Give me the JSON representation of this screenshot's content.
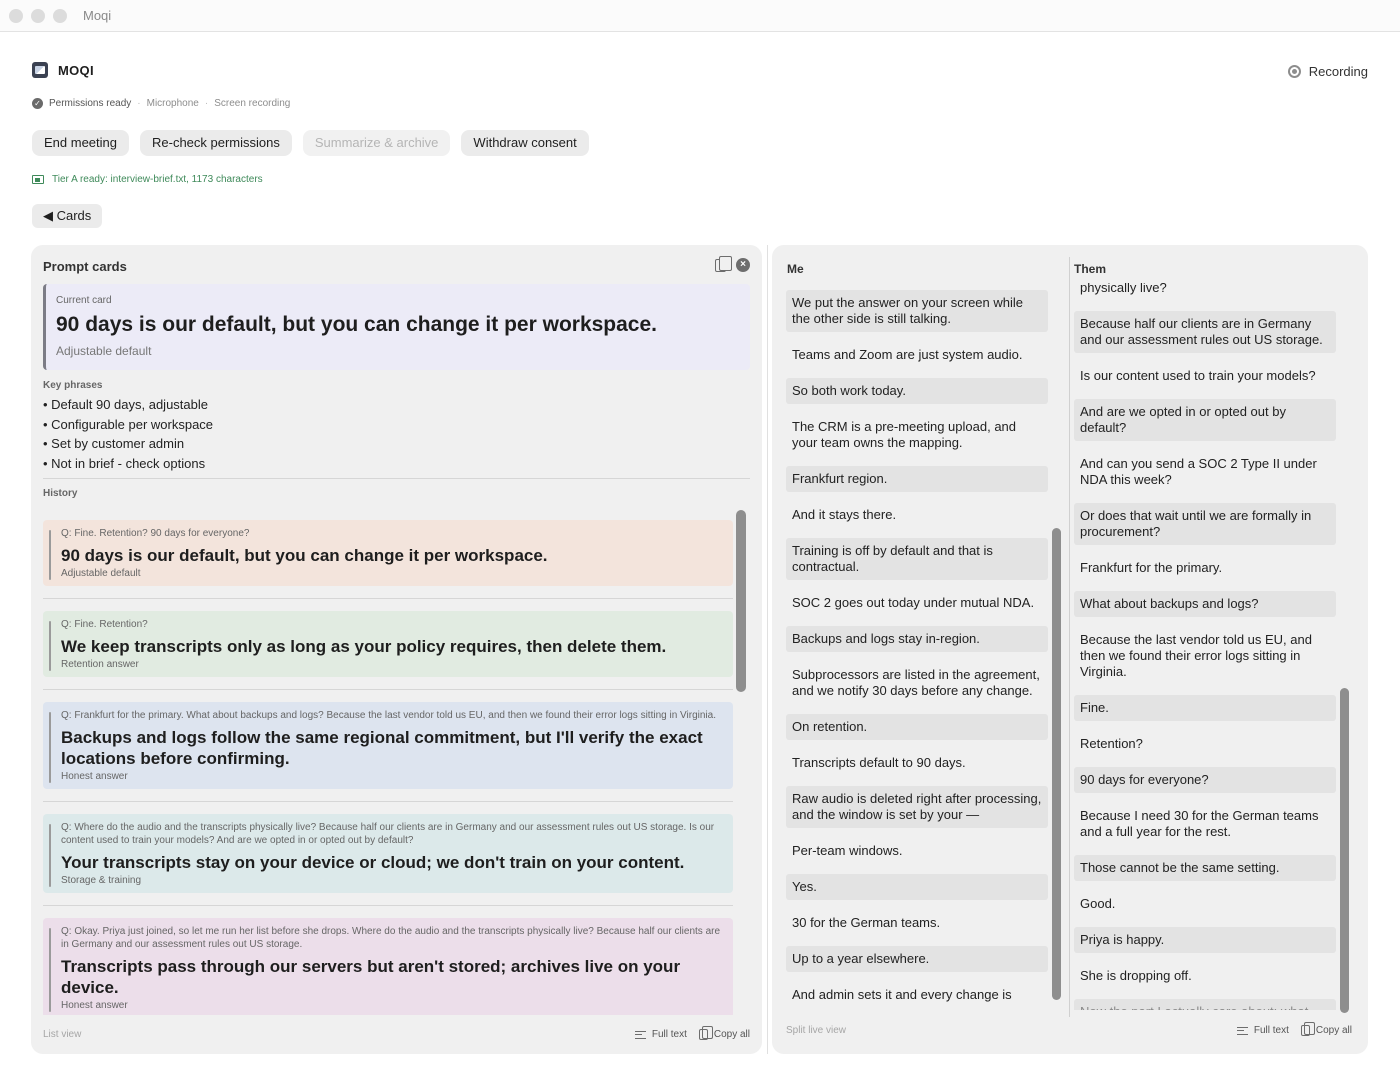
{
  "window": {
    "title": "Moqi"
  },
  "app": {
    "name": "MOQI",
    "recording_label": "Recording"
  },
  "permissions": {
    "ready": "Permissions ready",
    "microphone": "Microphone",
    "screen": "Screen recording",
    "separator": "·"
  },
  "buttons": {
    "end_meeting": "End meeting",
    "recheck": "Re-check permissions",
    "summarize": "Summarize & archive",
    "withdraw": "Withdraw consent"
  },
  "tier": {
    "text": "Tier A ready: interview-brief.txt, 1173 characters"
  },
  "cards_toggle": "◀ Cards",
  "prompt_panel": {
    "title": "Prompt cards",
    "current_card": {
      "label": "Current card",
      "title": "90 days is our default, but you can change it per workspace.",
      "subtitle": "Adjustable default"
    },
    "key_phrases_label": "Key phrases",
    "key_phrases": [
      "• Default 90 days, adjustable",
      "• Configurable per workspace",
      "• Set by customer admin",
      "• Not in brief - check options"
    ],
    "history_label": "History",
    "history": [
      {
        "q": "Q: Fine.  Retention?  90 days for everyone?",
        "a": "90 days is our default, but you can change it per workspace.",
        "tag": "Adjustable default",
        "color": "#f3e4dc"
      },
      {
        "q": "Q: Fine.  Retention?",
        "a": "We keep transcripts only as long as your policy requires, then delete them.",
        "tag": "Retention answer",
        "color": "#e1ebe1"
      },
      {
        "q": "Q: Frankfurt for the primary.  What about backups and logs?  Because the last vendor told us EU, and then we found their error logs sitting in Virginia.",
        "a": "Backups and logs follow the same regional commitment, but I'll verify the exact locations before confirming.",
        "tag": "Honest answer",
        "color": "#dde4ef"
      },
      {
        "q": "Q: Where do the audio and the transcripts physically live?  Because half our clients are in Germany and our assessment rules out US storage.  Is our content used to train your models?  And are we opted in or opted out by default?",
        "a": "Your transcripts stay on your device or cloud; we don't train on your content.",
        "tag": "Storage & training",
        "color": "#dce9ea"
      },
      {
        "q": "Q: Okay.  Priya just joined, so let me run her list before she drops.  Where do the audio and the transcripts physically live?  Because half our clients are in Germany and our assessment rules out US storage.",
        "a": "Transcripts pass through our servers but aren't stored; archives live on your device.",
        "tag": "Honest answer",
        "color": "#ecdeea"
      }
    ],
    "footer": {
      "view": "List view",
      "full_text": "Full text",
      "copy_all": "Copy all"
    }
  },
  "live_panel": {
    "me_label": "Me",
    "them_label": "Them",
    "me": [
      "We put the answer on your screen while the other side is still talking.",
      "Teams and Zoom are just system audio.",
      "So both work today.",
      "The CRM is a pre-meeting upload, and your team owns the mapping.",
      "Frankfurt region.",
      "And it stays there.",
      "Training is off by default and that is contractual.",
      "SOC 2 goes out today under mutual NDA.",
      "Backups and logs stay in-region.",
      "Subprocessors are listed in the agreement, and we notify 30 days before any change.",
      "On retention.",
      "Transcripts default to 90 days.",
      "Raw audio is deleted right after processing, and the window is set by your —",
      "Per-team windows.",
      "Yes.",
      "30 for the German teams.",
      "Up to a year elsewhere.",
      "And admin sets it and every change is logged."
    ],
    "them": [
      "physically live?",
      "Because half our clients are in Germany and our assessment rules out US storage.",
      "Is our content used to train your models?",
      "And are we opted in or opted out by default?",
      "And can you send a SOC 2 Type II under NDA this week?",
      "Or does that wait until we are formally in procurement?",
      "Frankfurt for the primary.",
      "What about backups and logs?",
      "Because the last vendor told us EU, and then we found their error logs sitting in Virginia.",
      "Fine.",
      "Retention?",
      "90 days for everyone?",
      "Because I need 30 for the German teams and a full year for the rest.",
      "Those cannot be the same setting.",
      "Good.",
      "Priya is happy.",
      "She is dropping off.",
      "Now the part I actually care about: what does this cost? And do not send me to a pricing page. I want the number for 6"
    ],
    "footer": {
      "view": "Split live view",
      "full_text": "Full text",
      "copy_all": "Copy all"
    }
  },
  "colors": {
    "accent_green": "#3f8a5a",
    "panel_bg": "#f0f0f0",
    "current_card_bg": "#ecebf7"
  }
}
